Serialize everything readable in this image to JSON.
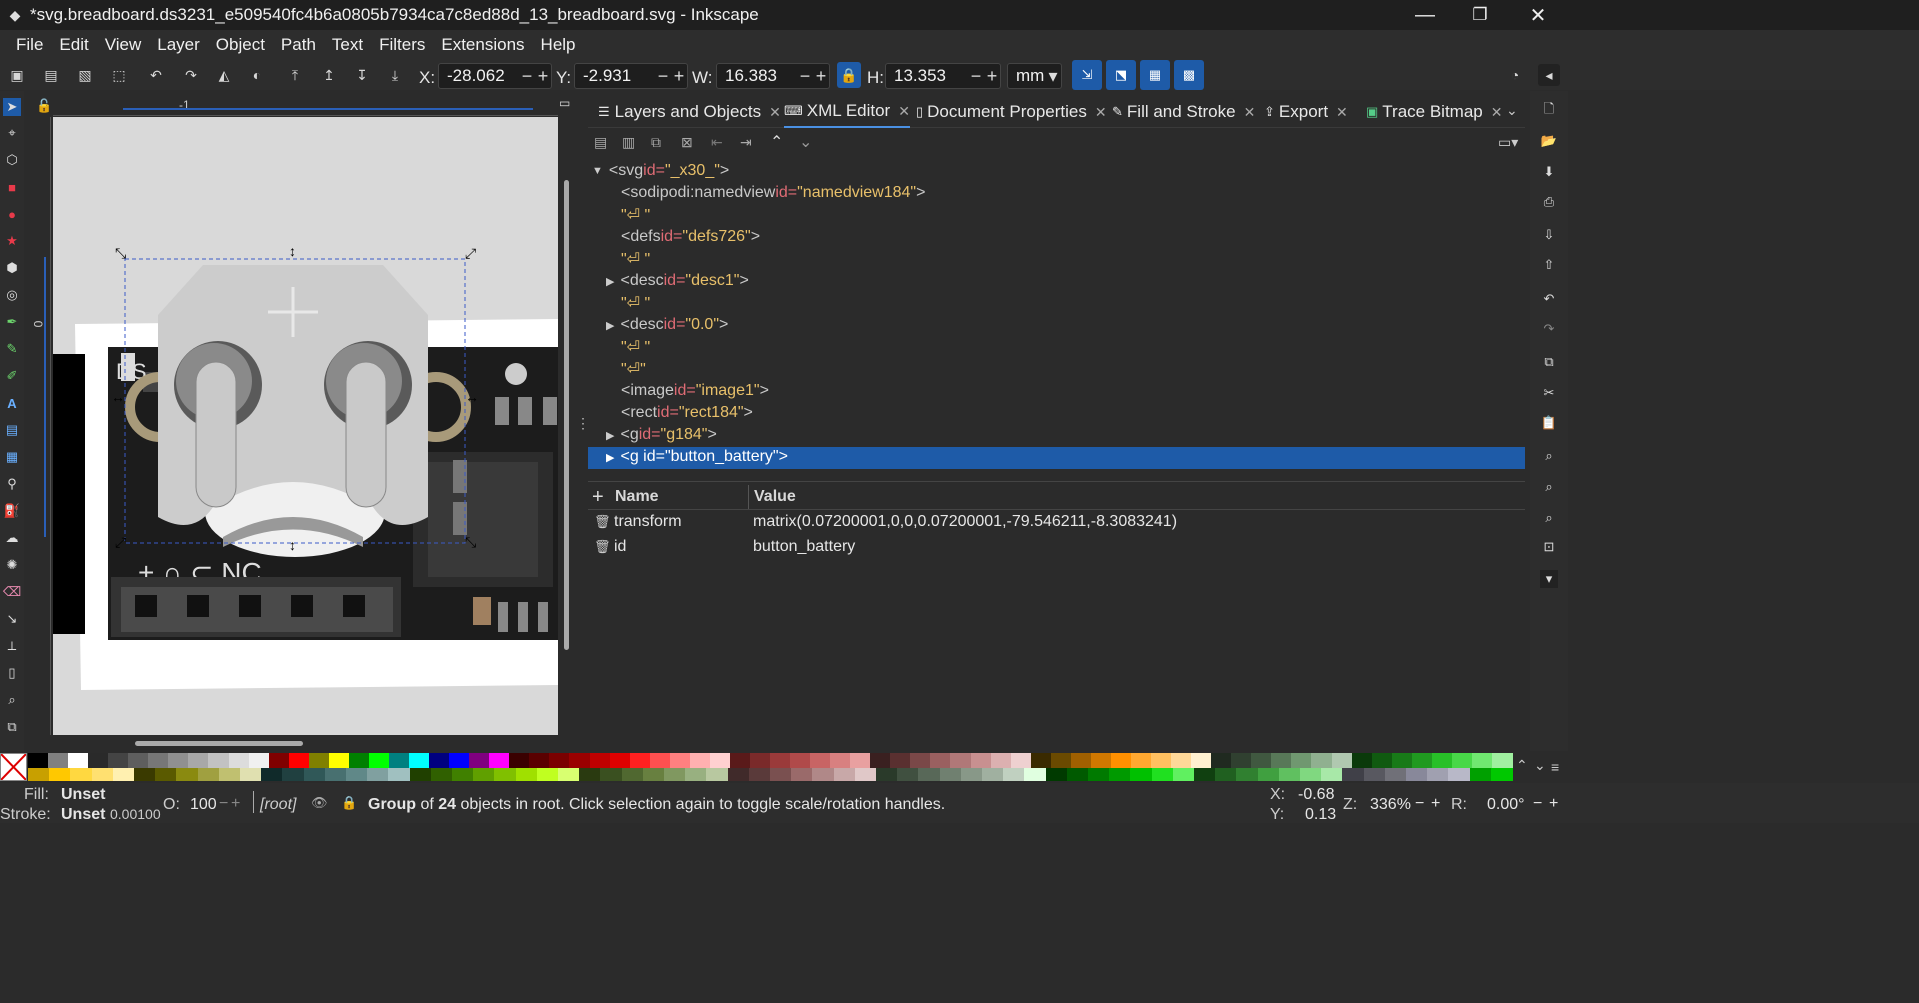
{
  "window": {
    "title": "*svg.breadboard.ds3231_e509540fc4b6a0805b7934ca7c8ed88d_13_breadboard.svg - Inkscape",
    "minimize": "—",
    "restore": "❐",
    "close": "✕"
  },
  "menu": [
    "File",
    "Edit",
    "View",
    "Layer",
    "Object",
    "Path",
    "Text",
    "Filters",
    "Extensions",
    "Help"
  ],
  "controls": {
    "x_label": "X:",
    "x_value": "-28.062",
    "y_label": "Y:",
    "y_value": "-2.931",
    "w_label": "W:",
    "w_value": "16.383",
    "h_label": "H:",
    "h_value": "13.353",
    "unit": "mm",
    "minus": "−",
    "plus": "+"
  },
  "ruler": {
    "h_mark": "-1",
    "v_mark": "0"
  },
  "tabs": [
    {
      "label": "Layers and Objects",
      "icon": "layers-icon"
    },
    {
      "label": "XML Editor",
      "icon": "xml-icon",
      "active": true
    },
    {
      "label": "Document Properties",
      "icon": "document-icon"
    },
    {
      "label": "Fill and Stroke",
      "icon": "fill-stroke-icon"
    },
    {
      "label": "Export",
      "icon": "export-icon"
    },
    {
      "label": "Trace Bitmap",
      "icon": "trace-bitmap-icon"
    }
  ],
  "xml_tree": {
    "svg": {
      "tag": "<svg",
      "attr": " id=",
      "val": "\"_x30_\"",
      "end": ">"
    },
    "namedview": {
      "tag": "<sodipodi:namedview",
      "attr": " id=",
      "val": "\"namedview184\"",
      "end": ">"
    },
    "text1": "\"⏎  \"",
    "defs": {
      "tag": "<defs",
      "attr": " id=",
      "val": "\"defs726\"",
      "end": ">"
    },
    "text2": "\"⏎  \"",
    "desc1": {
      "tag": "<desc",
      "attr": " id=",
      "val": "\"desc1\"",
      "end": ">"
    },
    "text3": "\"⏎  \"",
    "desc0": {
      "tag": "<desc",
      "attr": " id=",
      "val": "\"0.0\"",
      "end": ">"
    },
    "text4": "\"⏎  \"",
    "text5": "\"⏎\"",
    "image": {
      "tag": "<image",
      "attr": " id=",
      "val": "\"image1\"",
      "end": ">"
    },
    "rect": {
      "tag": "<rect",
      "attr": " id=",
      "val": "\"rect184\"",
      "end": ">"
    },
    "g184": {
      "tag": "<g",
      "attr": " id=",
      "val": "\"g184\"",
      "end": ">"
    },
    "battery": {
      "text": "<g id=\"button_battery\">"
    }
  },
  "attributes": {
    "add": "+",
    "name_header": "Name",
    "value_header": "Value",
    "rows": [
      {
        "name": "transform",
        "value": "matrix(0.07200001,0,0,0.07200001,-79.546211,-8.3083241)"
      },
      {
        "name": "id",
        "value": "button_battery"
      }
    ]
  },
  "status": {
    "fill_label": "Fill:",
    "fill_value": "Unset",
    "stroke_label": "Stroke:",
    "stroke_value": "Unset",
    "stroke_width": "0.00100",
    "opacity_label": "O:",
    "opacity_value": "100",
    "layer": "[root]",
    "msg_prefix": "Group",
    "msg_of": " of ",
    "msg_count": "24",
    "msg_rest": " objects in root. Click selection again to toggle scale/rotation handles.",
    "cursor_x_label": "X:",
    "cursor_x": "-0.68",
    "cursor_y_label": "Y:",
    "cursor_y": "0.13",
    "zoom_label": "Z:",
    "zoom": "336%",
    "rotation_label": "R:",
    "rotation": "0.00°"
  },
  "palette": {
    "top": [
      "#000000",
      "#808080",
      "#ffffff",
      "#2a2a2a",
      "#444444",
      "#5e5e5e",
      "#777777",
      "#909090",
      "#a8a8a8",
      "#c2c2c2",
      "#dcdcdc",
      "#f0f0f0",
      "#800000",
      "#ff0000",
      "#808000",
      "#ffff00",
      "#008000",
      "#00ff00",
      "#008080",
      "#00ffff",
      "#000080",
      "#0000ff",
      "#800080",
      "#ff00ff",
      "#3a0000",
      "#5a0000",
      "#7a0000",
      "#9a0000",
      "#c00000",
      "#e00000",
      "#ff2020",
      "#ff5050",
      "#ff8080",
      "#ffb0b0",
      "#ffd0d0",
      "#5a1a1a",
      "#7a2a2a",
      "#9a3a3a",
      "#b04a4a",
      "#c86464",
      "#d88080",
      "#e8a0a0",
      "#3a2020",
      "#5a3030",
      "#7a4848",
      "#9a6060",
      "#b07878",
      "#c89090",
      "#dcb0b0",
      "#eed0d0",
      "#3a2a00",
      "#6a4a00",
      "#a06000",
      "#d07800",
      "#ff9000",
      "#ffa830",
      "#ffc060",
      "#ffd898",
      "#fff0d0",
      "#202a20",
      "#304030",
      "#405840",
      "#587858",
      "#709870",
      "#90b090",
      "#b0c8b0",
      "#0a3a0a",
      "#105a10",
      "#187a18",
      "#209a20",
      "#28c028",
      "#48d848",
      "#70e870",
      "#a0f0a0"
    ],
    "bottom": [
      "#c8a000",
      "#ffc800",
      "#ffd840",
      "#ffe070",
      "#fff0b0",
      "#3a3a00",
      "#5a5a00",
      "#8a8a10",
      "#a0a040",
      "#c0c070",
      "#e0e0b0",
      "#102a2a",
      "#204040",
      "#305858",
      "#487070",
      "#608888",
      "#80a0a0",
      "#a0c0c0",
      "#204000",
      "#306000",
      "#408000",
      "#60a000",
      "#80c000",
      "#a0e000",
      "#c0ff20",
      "#d8ff70",
      "#2a3a10",
      "#3a5020",
      "#506830",
      "#688040",
      "#809860",
      "#98b080",
      "#b8c8a0",
      "#402a2a",
      "#5a3a3a",
      "#7a5050",
      "#9a6a6a",
      "#b08888",
      "#c8a8a8",
      "#e0c8c8",
      "#2a3a2a",
      "#405040",
      "#586858",
      "#708070",
      "#889888",
      "#a0b0a0",
      "#c0d0c0",
      "#e0ffe0",
      "#003a00",
      "#005a00",
      "#007a00",
      "#009a00",
      "#00c000",
      "#20e020",
      "#60f060",
      "#104010",
      "#206020",
      "#308030",
      "#40a040",
      "#60c060",
      "#80d880",
      "#a8e8a8",
      "#404048",
      "#585860",
      "#707078",
      "#88889a",
      "#a0a0b0",
      "#b8b8c8",
      "#00a000",
      "#00c800"
    ]
  }
}
